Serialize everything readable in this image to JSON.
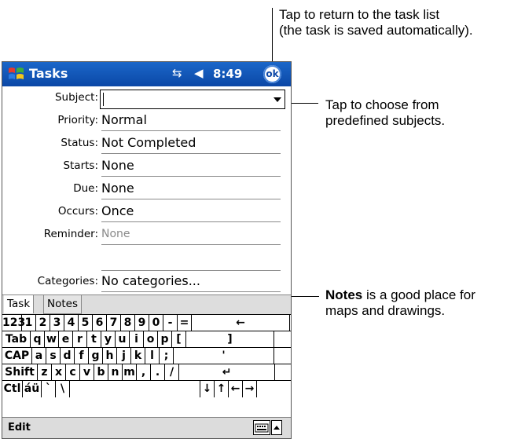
{
  "callouts": {
    "top_line1": "Tap to return to the task list",
    "top_line2": "(the task is saved automatically).",
    "subject_line1": "Tap to choose from",
    "subject_line2": "predefined subjects.",
    "notes_bold": "Notes",
    "notes_rest": " is a good place for",
    "notes_line2": "maps and drawings."
  },
  "titlebar": {
    "app_title": "Tasks",
    "connectivity_icon": "⇆",
    "volume_icon": "◀",
    "time": "8:49",
    "ok_label": "ok",
    "colors": {
      "bar": "#0b47a6",
      "text": "#ffffff"
    }
  },
  "form": {
    "subject": {
      "label": "Subject:",
      "value": ""
    },
    "priority": {
      "label": "Priority:",
      "value": "Normal"
    },
    "status": {
      "label": "Status:",
      "value": "Not Completed"
    },
    "starts": {
      "label": "Starts:",
      "value": "None"
    },
    "due": {
      "label": "Due:",
      "value": "None"
    },
    "occurs": {
      "label": "Occurs:",
      "value": "Once"
    },
    "reminder": {
      "label": "Reminder:",
      "value": "None"
    },
    "categories": {
      "label": "Categories:",
      "value": "No categories..."
    }
  },
  "tabs": {
    "task": "Task",
    "notes": "Notes"
  },
  "keyboard": {
    "row1": [
      "123",
      "1",
      "2",
      "3",
      "4",
      "5",
      "6",
      "7",
      "8",
      "9",
      "0",
      "-",
      "=",
      "←"
    ],
    "row2": [
      "Tab",
      "q",
      "w",
      "e",
      "r",
      "t",
      "y",
      "u",
      "i",
      "o",
      "p",
      "[",
      "]"
    ],
    "row3": [
      "CAP",
      "a",
      "s",
      "d",
      "f",
      "g",
      "h",
      "j",
      "k",
      "l",
      ";",
      "'"
    ],
    "row4": [
      "Shift",
      "z",
      "x",
      "c",
      "v",
      "b",
      "n",
      "m",
      ",",
      ".",
      "/",
      "↵"
    ],
    "row5": [
      "Ctl",
      "áü",
      "`",
      "\\",
      "",
      "↓",
      "↑",
      "←",
      "→"
    ]
  },
  "commandbar": {
    "edit": "Edit"
  }
}
